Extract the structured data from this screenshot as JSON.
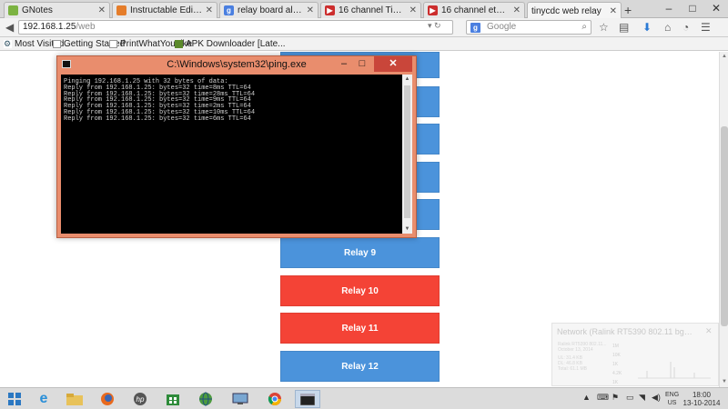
{
  "browser": {
    "tabs": [
      {
        "label": "GNotes",
        "icon": "gnotes-icon",
        "color": "#7cb342",
        "active": false
      },
      {
        "label": "Instructable Editor",
        "icon": "instructables-icon",
        "color": "#e57d2a",
        "active": false
      },
      {
        "label": "relay board aliexpress - ...",
        "icon": "google-icon",
        "color": "#4a7fe0",
        "active": false
      },
      {
        "label": "16 channel Timer relay ...",
        "icon": "youtube-icon",
        "color": "#cc2d2d",
        "active": false
      },
      {
        "label": "16 channel ethernet Net...",
        "icon": "youtube-icon",
        "color": "#cc2d2d",
        "active": false
      },
      {
        "label": "tinycdc web relay",
        "icon": "blank-page-icon",
        "color": "#ffffff",
        "active": true
      }
    ],
    "new_tab": "+",
    "window_controls": {
      "minimize": "–",
      "maximize": "□",
      "close": "✕"
    },
    "url": {
      "host": "192.168.1.25",
      "path": "/web"
    },
    "search_placeholder": "Google",
    "search_engine_letter": "g",
    "bookmarks": [
      {
        "label": "Most Visited",
        "icon": "gear-icon"
      },
      {
        "label": "Getting Started",
        "icon": "page-icon"
      },
      {
        "label": "PrintWhatYouLike",
        "icon": "page-icon"
      },
      {
        "label": "APK Downloader [Late...",
        "icon": "android-icon"
      }
    ]
  },
  "relays": [
    {
      "label": "Relay 9",
      "state": "off"
    },
    {
      "label": "Relay 10",
      "state": "on"
    },
    {
      "label": "Relay 11",
      "state": "on"
    },
    {
      "label": "Relay 12",
      "state": "off"
    }
  ],
  "colors": {
    "relay_on": "#f44336",
    "relay_off": "#4b93db",
    "console_frame": "#e98d6d"
  },
  "console": {
    "title": "C:\\Windows\\system32\\ping.exe",
    "lines": [
      "Pinging 192.168.1.25 with 32 bytes of data:",
      "Reply from 192.168.1.25: bytes=32 time=8ms TTL=64",
      "Reply from 192.168.1.25: bytes=32 time=28ms TTL=64",
      "Reply from 192.168.1.25: bytes=32 time=9ms TTL=64",
      "Reply from 192.168.1.25: bytes=32 time=2ms TTL=64",
      "Reply from 192.168.1.25: bytes=32 time=10ms TTL=64",
      "Reply from 192.168.1.25: bytes=32 time=6ms TTL=64"
    ]
  },
  "network_widget": {
    "title": "Network (Ralink RT5390 802.11 bgn Wi...",
    "details": [
      "Ralink RT5390 802.11...",
      "October 13, 2014",
      "UL: 31.4 KB",
      "DL: 46.8 KB",
      "Total: 61.1 MB"
    ],
    "axis": [
      "1M",
      "10K",
      "1K",
      "4.2K",
      "1K"
    ]
  },
  "taskbar": {
    "apps": [
      "ie-icon",
      "file-explorer-icon",
      "firefox-icon",
      "hp-icon",
      "store-icon",
      "network-globe-icon",
      "remote-desktop-icon",
      "chrome-icon",
      "cmd-window-icon"
    ],
    "language": {
      "top": "ENG",
      "bottom": "US"
    },
    "clock": {
      "time": "18:00",
      "date": "13-10-2014"
    }
  }
}
